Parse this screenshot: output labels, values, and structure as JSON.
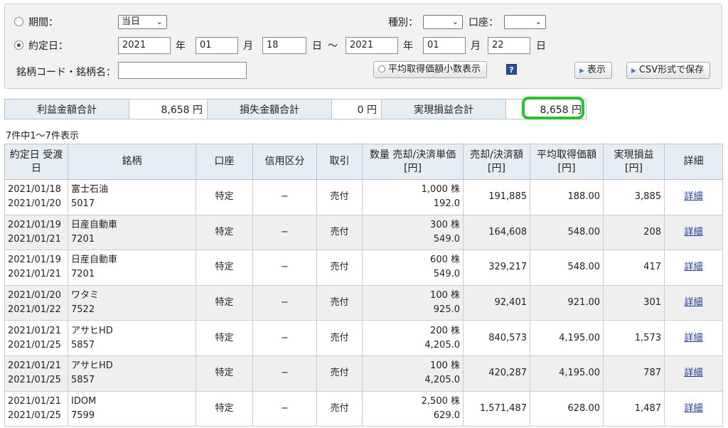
{
  "filter": {
    "period_label": "期間：",
    "period_value": "当日",
    "trade_date_label": "約定日：",
    "from_year": "2021",
    "from_month": "01",
    "from_day": "18",
    "to_year": "2021",
    "to_month": "01",
    "to_day": "22",
    "year_unit": "年",
    "month_unit": "月",
    "day_unit": "日",
    "range_sep": "〜",
    "type_label": "種別：",
    "type_value": "",
    "account_label": "口座：",
    "account_value": "",
    "code_label": "銘柄コード・銘柄名：",
    "code_value": "",
    "avg_button": "平均取得価額小数表示",
    "help_icon": "?",
    "show_button": "表示",
    "csv_button": "CSV形式で保存"
  },
  "summary": {
    "profit_label": "利益金額合計",
    "profit_value": "8,658 円",
    "loss_label": "損失金額合計",
    "loss_value": "0 円",
    "realized_label": "実現損益合計",
    "realized_value": "8,658 円"
  },
  "count_text": "7件中1〜7件表示",
  "table": {
    "headers": {
      "date_1": "約定日",
      "date_2": "受渡日",
      "stock": "銘柄",
      "account": "口座",
      "credit": "信用区分",
      "trade": "取引",
      "qty_1": "数量",
      "qty_2": "売却/決済単価[円]",
      "sale_1": "売却/決済額",
      "sale_2": "[円]",
      "avg_1": "平均取得価額",
      "avg_2": "[円]",
      "pl_1": "実現損益",
      "pl_2": "[円]",
      "detail": "詳細"
    },
    "rows": [
      {
        "trade_date": "2021/01/18",
        "settle_date": "2021/01/20",
        "name": "富士石油",
        "code": "5017",
        "account": "特定",
        "credit": "−",
        "trade": "売付",
        "qty": "1,000 株",
        "price": "192.0",
        "amount": "191,885",
        "avg": "188.00",
        "pl": "3,885",
        "detail": "詳細"
      },
      {
        "trade_date": "2021/01/19",
        "settle_date": "2021/01/21",
        "name": "日産自動車",
        "code": "7201",
        "account": "特定",
        "credit": "−",
        "trade": "売付",
        "qty": "300 株",
        "price": "549.0",
        "amount": "164,608",
        "avg": "548.00",
        "pl": "208",
        "detail": "詳細"
      },
      {
        "trade_date": "2021/01/19",
        "settle_date": "2021/01/21",
        "name": "日産自動車",
        "code": "7201",
        "account": "特定",
        "credit": "−",
        "trade": "売付",
        "qty": "600 株",
        "price": "549.0",
        "amount": "329,217",
        "avg": "548.00",
        "pl": "417",
        "detail": "詳細"
      },
      {
        "trade_date": "2021/01/20",
        "settle_date": "2021/01/22",
        "name": "ワタミ",
        "code": "7522",
        "account": "特定",
        "credit": "−",
        "trade": "売付",
        "qty": "100 株",
        "price": "925.0",
        "amount": "92,401",
        "avg": "921.00",
        "pl": "301",
        "detail": "詳細"
      },
      {
        "trade_date": "2021/01/21",
        "settle_date": "2021/01/25",
        "name": "アサヒHD",
        "code": "5857",
        "account": "特定",
        "credit": "−",
        "trade": "売付",
        "qty": "200 株",
        "price": "4,205.0",
        "amount": "840,573",
        "avg": "4,195.00",
        "pl": "1,573",
        "detail": "詳細"
      },
      {
        "trade_date": "2021/01/21",
        "settle_date": "2021/01/25",
        "name": "アサヒHD",
        "code": "5857",
        "account": "特定",
        "credit": "−",
        "trade": "売付",
        "qty": "100 株",
        "price": "4,205.0",
        "amount": "420,287",
        "avg": "4,195.00",
        "pl": "787",
        "detail": "詳細"
      },
      {
        "trade_date": "2021/01/21",
        "settle_date": "2021/01/25",
        "name": "IDOM",
        "code": "7599",
        "account": "特定",
        "credit": "−",
        "trade": "売付",
        "qty": "2,500 株",
        "price": "629.0",
        "amount": "1,571,487",
        "avg": "628.00",
        "pl": "1,487",
        "detail": "詳細"
      }
    ]
  },
  "colors": {
    "header_bg": "#e6edf3",
    "alt_row_bg": "#efefef",
    "highlight_ring": "#25c525",
    "link": "#1a3aa8"
  }
}
